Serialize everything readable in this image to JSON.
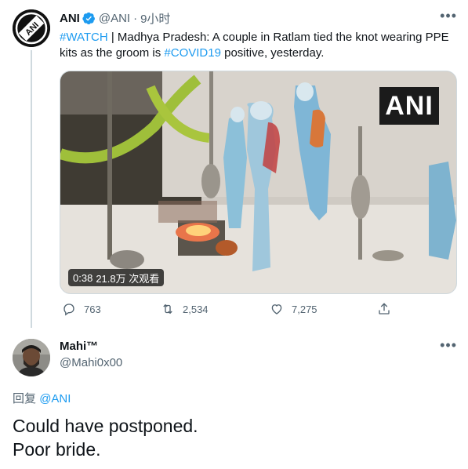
{
  "tweet": {
    "author_name": "ANI",
    "author_handle": "@ANI",
    "separator": "·",
    "time": "9小时",
    "text_parts": {
      "hashtag1": "#WATCH",
      "text1": " | Madhya Pradesh: A couple in Ratlam tied the knot wearing PPE kits as the groom is ",
      "hashtag2": "#COVID19",
      "text2": " positive, yesterday."
    },
    "media": {
      "overlay_logo": "ANI",
      "duration": "0:38",
      "views": "21.8万 次观看"
    },
    "stats": {
      "replies": "763",
      "retweets": "2,534",
      "likes": "7,275"
    },
    "more_icon": "more-horizontal-icon"
  },
  "reply": {
    "author_name": "Mahi™",
    "author_handle": "@Mahi0x00",
    "replying_prefix": "回复",
    "replying_to": "@ANI",
    "line1": "Could have postponed.",
    "line2": "Poor bride."
  },
  "colors": {
    "link": "#1d9bf0",
    "secondary_text": "#536471",
    "primary_text": "#0f1419",
    "divider": "#cfd9de"
  }
}
